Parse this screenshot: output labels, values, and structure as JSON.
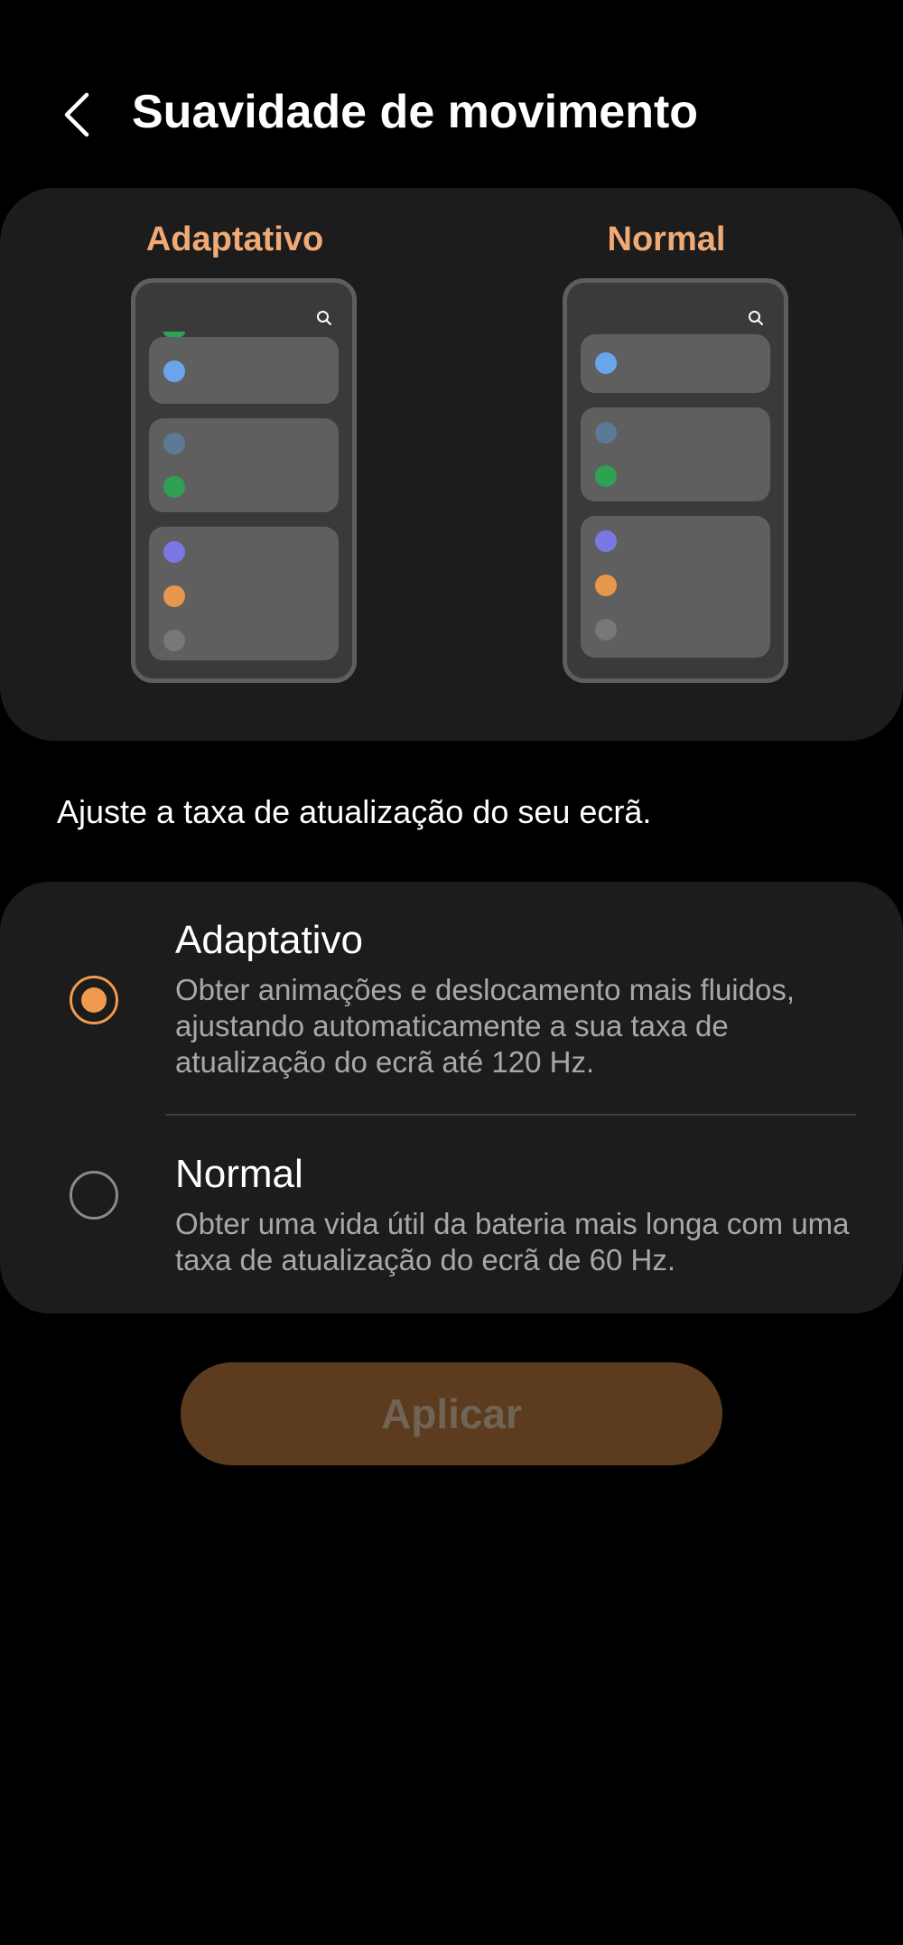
{
  "header": {
    "title": "Suavidade de movimento",
    "back_icon": "chevron-left-icon"
  },
  "preview": {
    "adaptive_label": "Adaptativo",
    "normal_label": "Normal"
  },
  "description": "Ajuste a taxa de atualização do seu ecrã.",
  "options": [
    {
      "title": "Adaptativo",
      "description": "Obter animações e deslocamento mais fluidos, ajustando automaticamente a sua taxa de atualização do ecrã até 120 Hz.",
      "selected": true
    },
    {
      "title": "Normal",
      "description": "Obter uma vida útil da bateria mais longa com uma taxa de atualização do ecrã de 60 Hz.",
      "selected": false
    }
  ],
  "apply_button": {
    "label": "Aplicar",
    "enabled": false
  },
  "colors": {
    "accent": "#f0aa75",
    "radio_selected": "#f09a4e",
    "dot_blue": "#6aa5ec",
    "dot_slate": "#5c7a96",
    "dot_green": "#2fa152",
    "dot_purple": "#7b78e6",
    "dot_orange": "#e8984c",
    "dot_gray": "#787878",
    "apply_bg": "#5c3b1e"
  }
}
